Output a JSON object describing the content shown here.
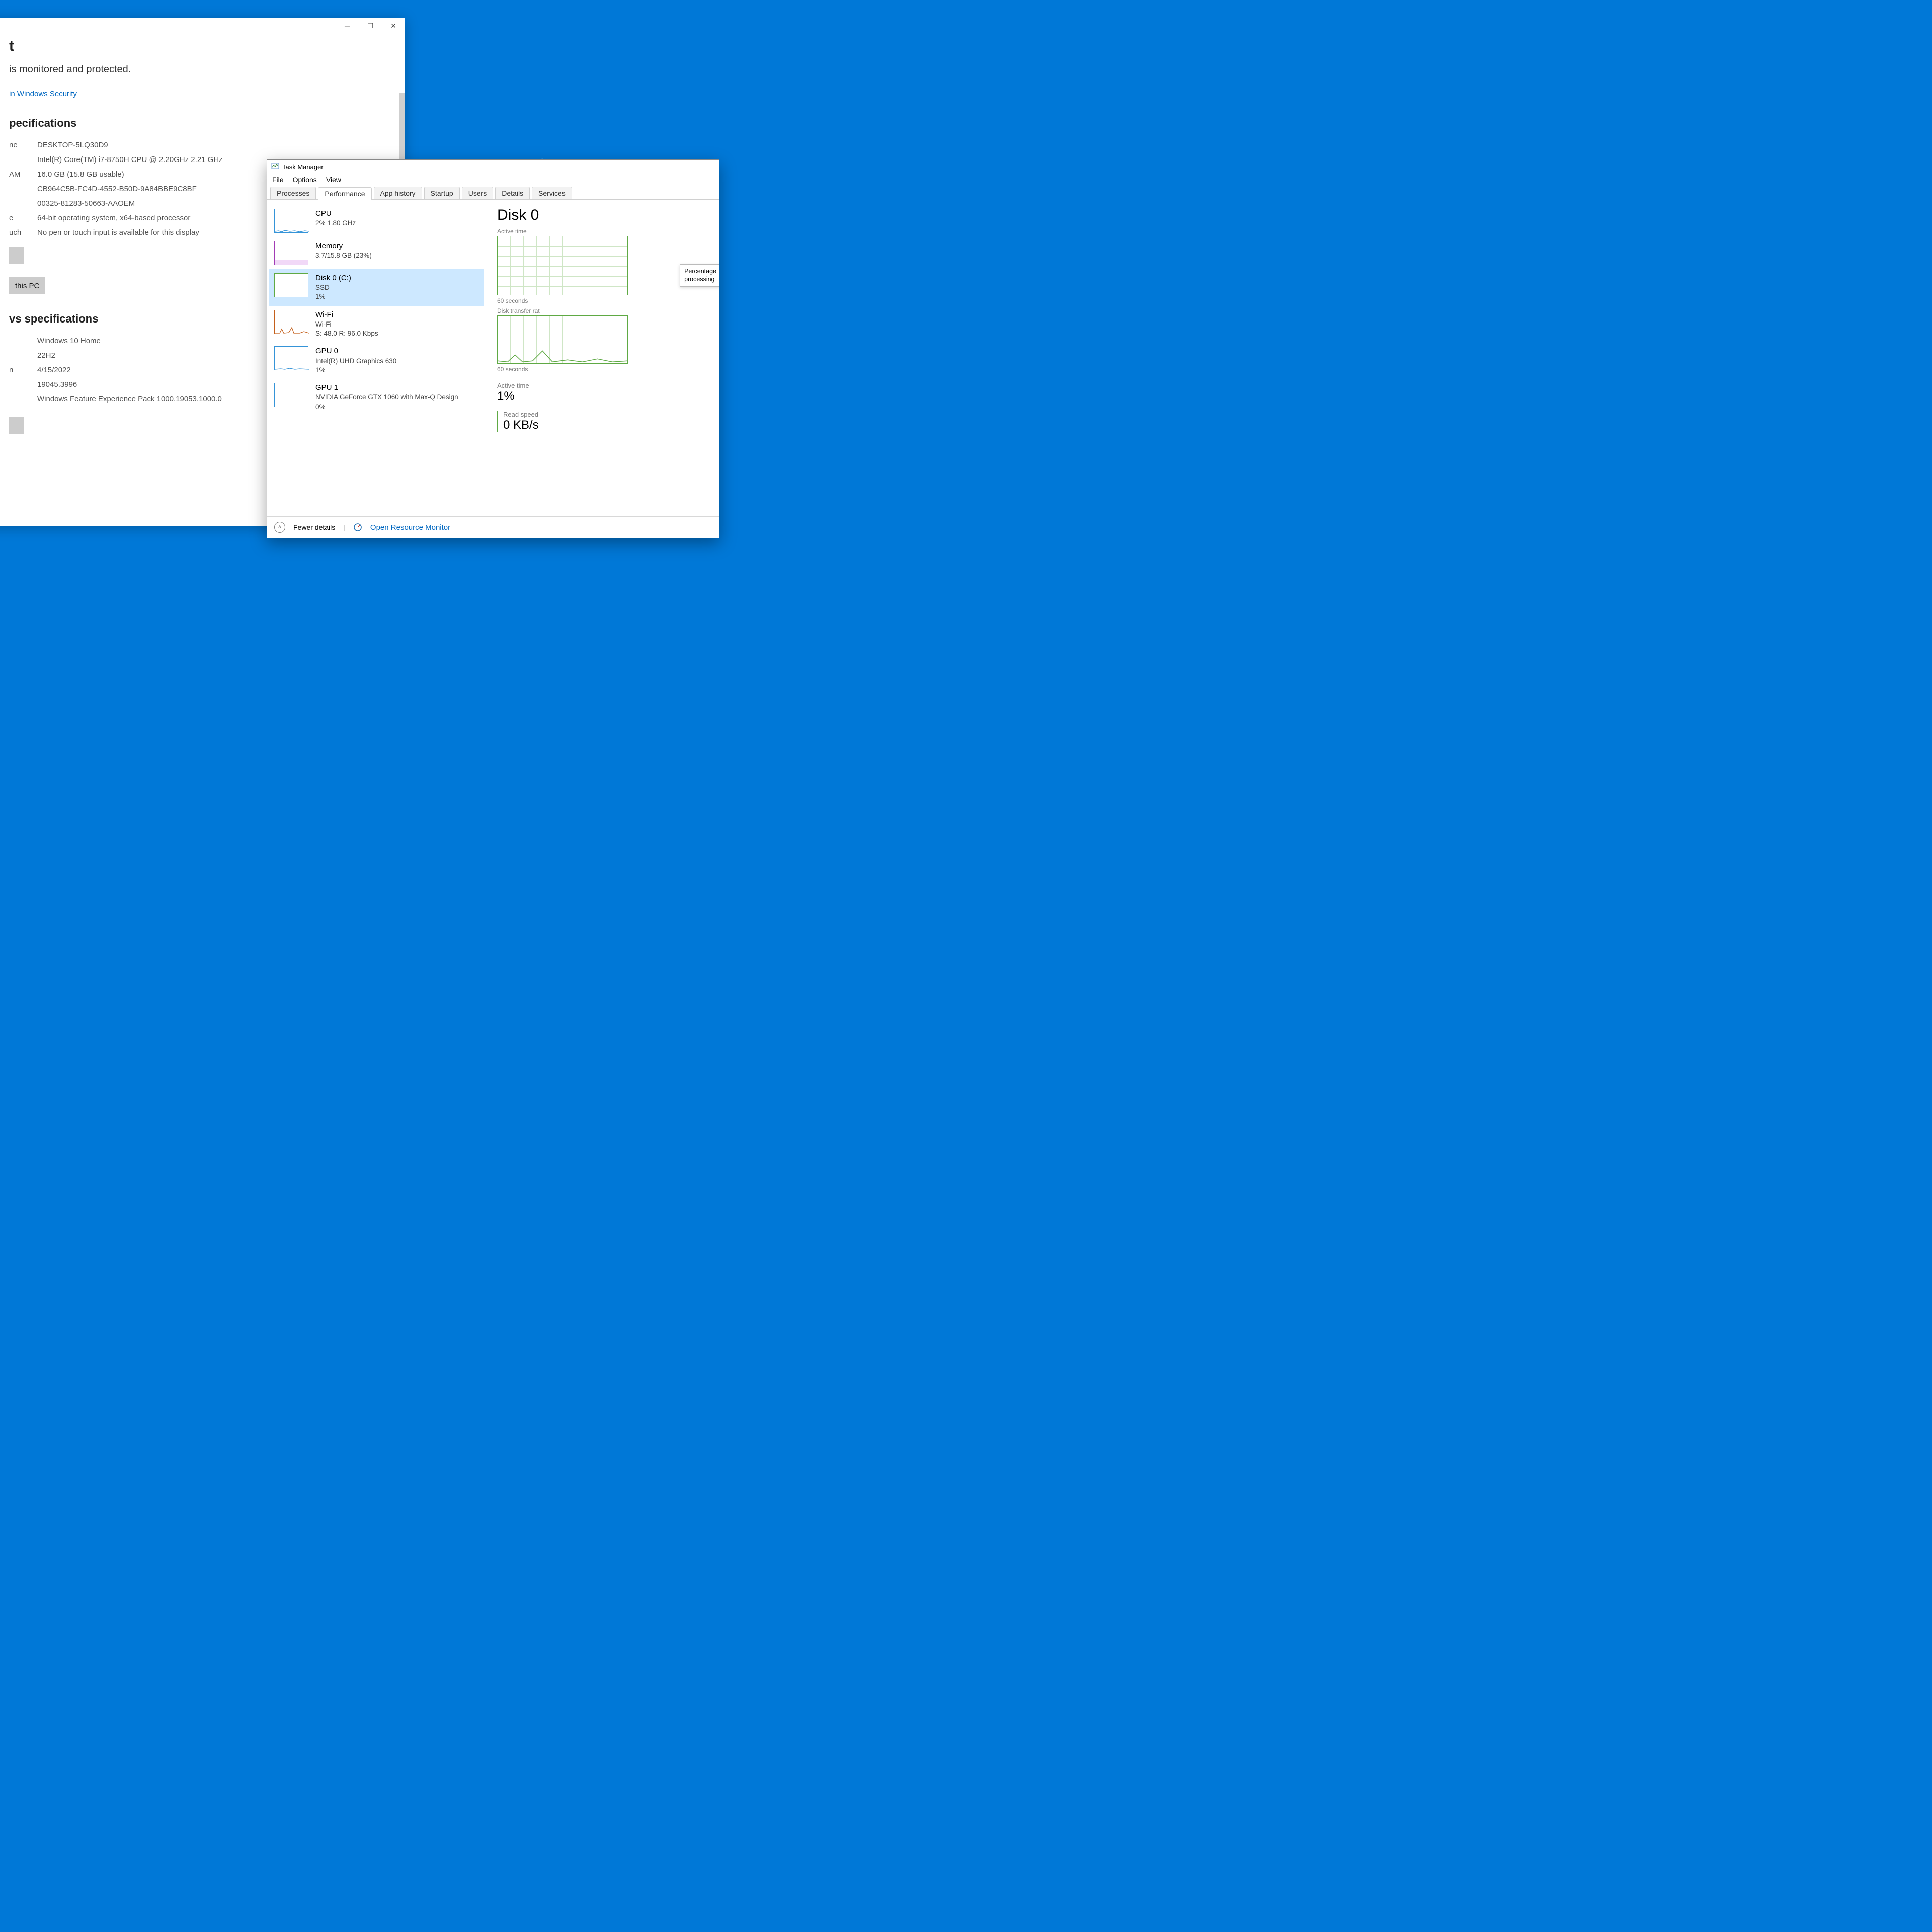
{
  "settings": {
    "title_tail": "t",
    "monitored_text": "is monitored and protected.",
    "link_text": "in Windows Security",
    "dev_header_tail": "pecifications",
    "rows": {
      "name_lab": "ne",
      "name_val": "DESKTOP-5LQ30D9",
      "cpu_val": "Intel(R) Core(TM) i7-8750H CPU @ 2.20GHz   2.21 GHz",
      "ram_lab": "AM",
      "ram_val": "16.0 GB (15.8 GB usable)",
      "devid_val": "CB964C5B-FC4D-4552-B50D-9A84BBE9C8BF",
      "prodid_val": "00325-81283-50663-AAOEM",
      "type_lab": "e",
      "type_val": "64-bit operating system, x64-based processor",
      "touch_lab": "uch",
      "touch_val": "No pen or touch input is available for this display"
    },
    "rename_btn": "this PC",
    "win_header_tail": "vs specifications",
    "win": {
      "edition": "Windows 10 Home",
      "version": "22H2",
      "inst_lab_tail": "n",
      "inst_date": "4/15/2022",
      "build": "19045.3996",
      "pack": "Windows Feature Experience Pack 1000.19053.1000.0"
    }
  },
  "taskman": {
    "title": "Task Manager",
    "menu": [
      "File",
      "Options",
      "View"
    ],
    "tabs": [
      "Processes",
      "Performance",
      "App history",
      "Startup",
      "Users",
      "Details",
      "Services"
    ],
    "left": {
      "cpu": {
        "name": "CPU",
        "det": "2%  1.80 GHz"
      },
      "mem": {
        "name": "Memory",
        "det": "3.7/15.8 GB (23%)"
      },
      "disk": {
        "name": "Disk 0 (C:)",
        "det1": "SSD",
        "det2": "1%"
      },
      "wifi": {
        "name": "Wi-Fi",
        "det1": "Wi-Fi",
        "det2": "S: 48.0  R: 96.0 Kbps"
      },
      "gpu0": {
        "name": "GPU 0",
        "det1": "Intel(R) UHD Graphics 630",
        "det2": "1%"
      },
      "gpu1": {
        "name": "GPU 1",
        "det1": "NVIDIA GeForce GTX 1060 with Max-Q Design",
        "det2": "0%"
      }
    },
    "right": {
      "title": "Disk 0",
      "cap1": "Active time",
      "cap_60": "60 seconds",
      "cap2": "Disk transfer rat",
      "tooltip1": "Percentage",
      "tooltip2": "processing",
      "m_active_lab": "Active time",
      "m_active_val": "1%",
      "m_read_lab": "Read speed",
      "m_read_val": "0 KB/s"
    },
    "footer": {
      "fewer": "Fewer details",
      "resmon": "Open Resource Monitor"
    }
  }
}
